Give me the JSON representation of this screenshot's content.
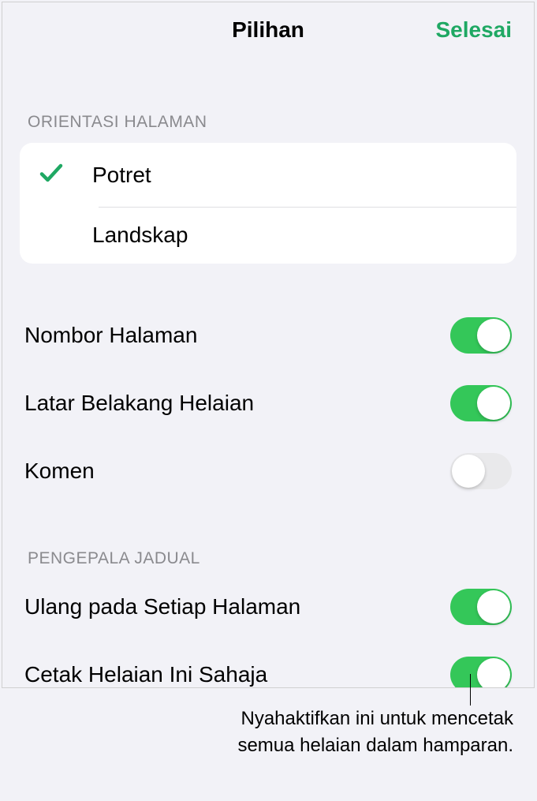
{
  "header": {
    "title": "Pilihan",
    "done": "Selesai"
  },
  "orientation": {
    "section_label": "ORIENTASI HALAMAN",
    "portrait": "Potret",
    "landscape": "Landskap",
    "selected": "portrait"
  },
  "toggles": {
    "page_numbers": {
      "label": "Nombor Halaman",
      "on": true
    },
    "sheet_background": {
      "label": "Latar Belakang Helaian",
      "on": true
    },
    "comments": {
      "label": "Komen",
      "on": false
    }
  },
  "table_headers": {
    "section_label": "PENGEPALA JADUAL",
    "repeat_each_page": {
      "label": "Ulang pada Setiap Halaman",
      "on": true
    },
    "print_this_sheet_only": {
      "label": "Cetak Helaian Ini Sahaja",
      "on": true
    }
  },
  "callout": "Nyahaktifkan ini untuk mencetak semua helaian dalam hamparan.",
  "colors": {
    "accent": "#1fa863",
    "toggle_on": "#34c759"
  }
}
